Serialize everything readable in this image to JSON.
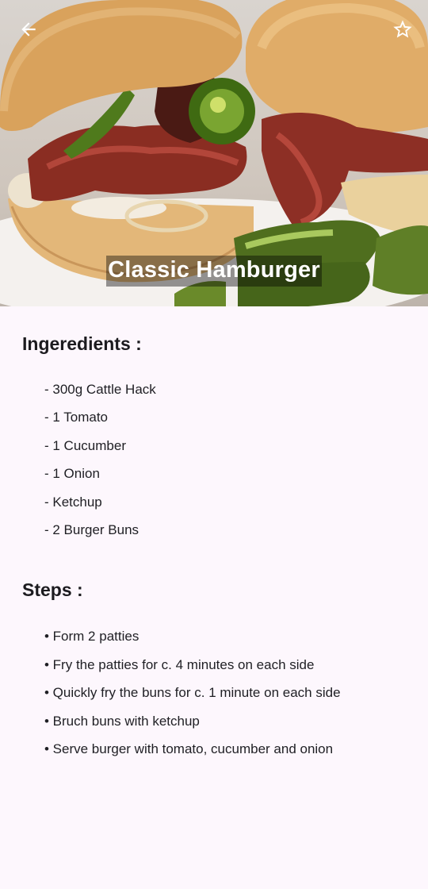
{
  "recipe": {
    "title": "Classic Hamburger"
  },
  "nav": {
    "back_icon": "arrow-left-icon",
    "favorite_icon": "star-outline-icon"
  },
  "ingredients": {
    "heading": "Ingeredients :",
    "items": [
      "- 300g Cattle Hack",
      "- 1 Tomato",
      "- 1 Cucumber",
      "- 1 Onion",
      "- Ketchup",
      "- 2 Burger Buns"
    ]
  },
  "steps": {
    "heading": "Steps :",
    "items": [
      "• Form 2 patties",
      "• Fry the patties for c. 4 minutes on each side",
      "• Quickly fry the buns for c. 1 minute on each side",
      "• Bruch buns with ketchup",
      "• Serve burger with tomato, cucumber and onion"
    ]
  },
  "colors": {
    "background": "#fdf7fd",
    "text": "#1c1b1f",
    "title_text": "#ffffff"
  }
}
